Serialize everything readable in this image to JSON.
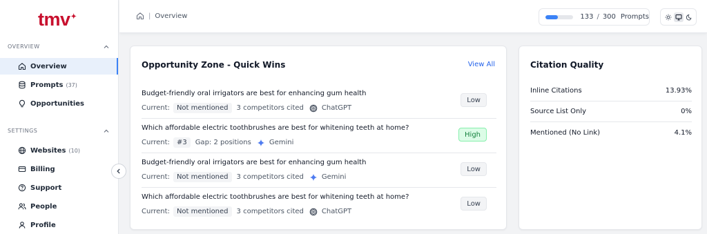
{
  "brand": {
    "logo_text": "tmv",
    "logo_dot": "✦"
  },
  "sidebar": {
    "section_overview": "OVERVIEW",
    "section_settings": "SETTINGS",
    "overview_items": [
      {
        "label": "Overview",
        "count": "",
        "icon": "home-icon"
      },
      {
        "label": "Prompts",
        "count": "(37)",
        "icon": "database-icon"
      },
      {
        "label": "Opportunities",
        "count": "",
        "icon": "lightbulb-icon"
      }
    ],
    "settings_items": [
      {
        "label": "Websites",
        "count": "(10)",
        "icon": "globe-icon"
      },
      {
        "label": "Billing",
        "count": "",
        "icon": "credit-card-icon"
      },
      {
        "label": "Support",
        "count": "",
        "icon": "help-circle-icon"
      },
      {
        "label": "People",
        "count": "",
        "icon": "users-icon"
      },
      {
        "label": "Profile",
        "count": "",
        "icon": "user-icon"
      }
    ]
  },
  "header": {
    "breadcrumb": "Overview",
    "prompts_used": "133",
    "prompts_sep": "/",
    "prompts_total": "300",
    "prompts_label": "Prompts",
    "prompts_progress": 0.443,
    "theme_options": [
      "sun-icon",
      "monitor-icon",
      "moon-icon"
    ],
    "theme_selected": "monitor-icon"
  },
  "opportunity": {
    "title": "Opportunity Zone - Quick Wins",
    "view_all": "View All",
    "rows": [
      {
        "question": "Budget-friendly oral irrigators are best for enhancing gum health",
        "current_label": "Current:",
        "current": "Not mentioned",
        "detail": "3 competitors cited",
        "model": "ChatGPT",
        "model_icon": "openai-icon",
        "priority": "Low"
      },
      {
        "question": "Which affordable electric toothbrushes are best for whitening teeth at home?",
        "current_label": "Current:",
        "current": "#3",
        "detail": "Gap: 2 positions",
        "model": "Gemini",
        "model_icon": "gemini-icon",
        "priority": "High"
      },
      {
        "question": "Budget-friendly oral irrigators are best for enhancing gum health",
        "current_label": "Current:",
        "current": "Not mentioned",
        "detail": "3 competitors cited",
        "model": "Gemini",
        "model_icon": "gemini-icon",
        "priority": "Low"
      },
      {
        "question": "Which affordable electric toothbrushes are best for whitening teeth at home?",
        "current_label": "Current:",
        "current": "Not mentioned",
        "detail": "3 competitors cited",
        "model": "ChatGPT",
        "model_icon": "openai-icon",
        "priority": "Low"
      }
    ]
  },
  "citation": {
    "title": "Citation Quality",
    "rows": [
      {
        "label": "Inline Citations",
        "value": "13.93%"
      },
      {
        "label": "Source List Only",
        "value": "0%"
      },
      {
        "label": "Mentioned (No Link)",
        "value": "4.1%"
      }
    ]
  },
  "colors": {
    "brand": "#c8102e",
    "accent": "#3b82f6",
    "link": "#2563eb",
    "high_bg": "#dcfce7",
    "high_text": "#15803d"
  }
}
